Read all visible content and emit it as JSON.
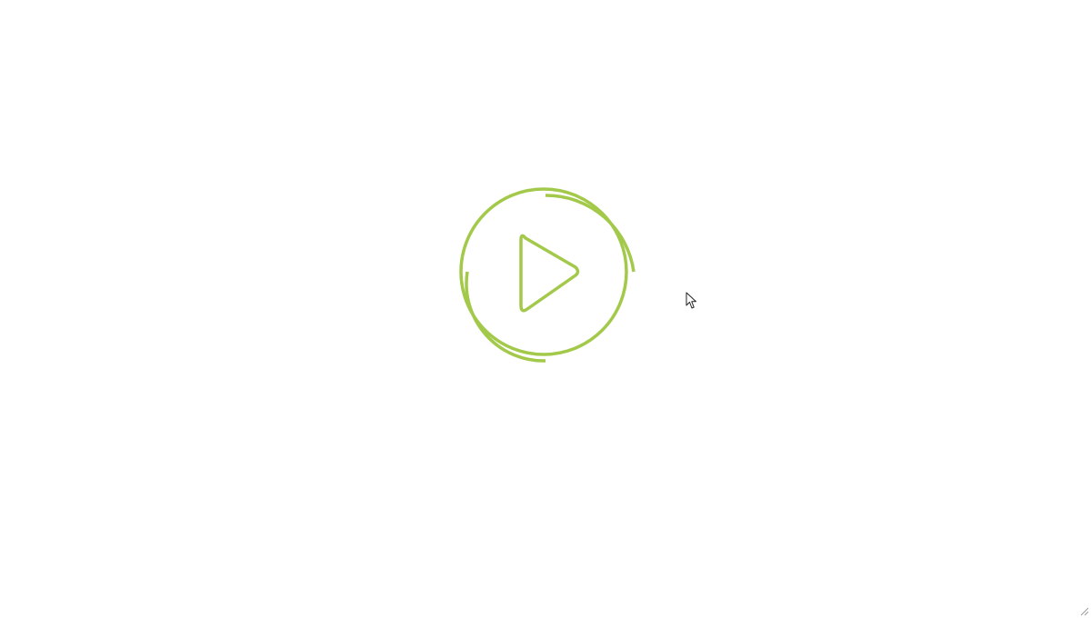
{
  "player": {
    "accent_color": "#a3c94a",
    "icon": "play-circle-icon"
  },
  "cursor": {
    "icon": "mouse-pointer-icon"
  },
  "window": {
    "resize_icon": "resize-grip-icon"
  }
}
